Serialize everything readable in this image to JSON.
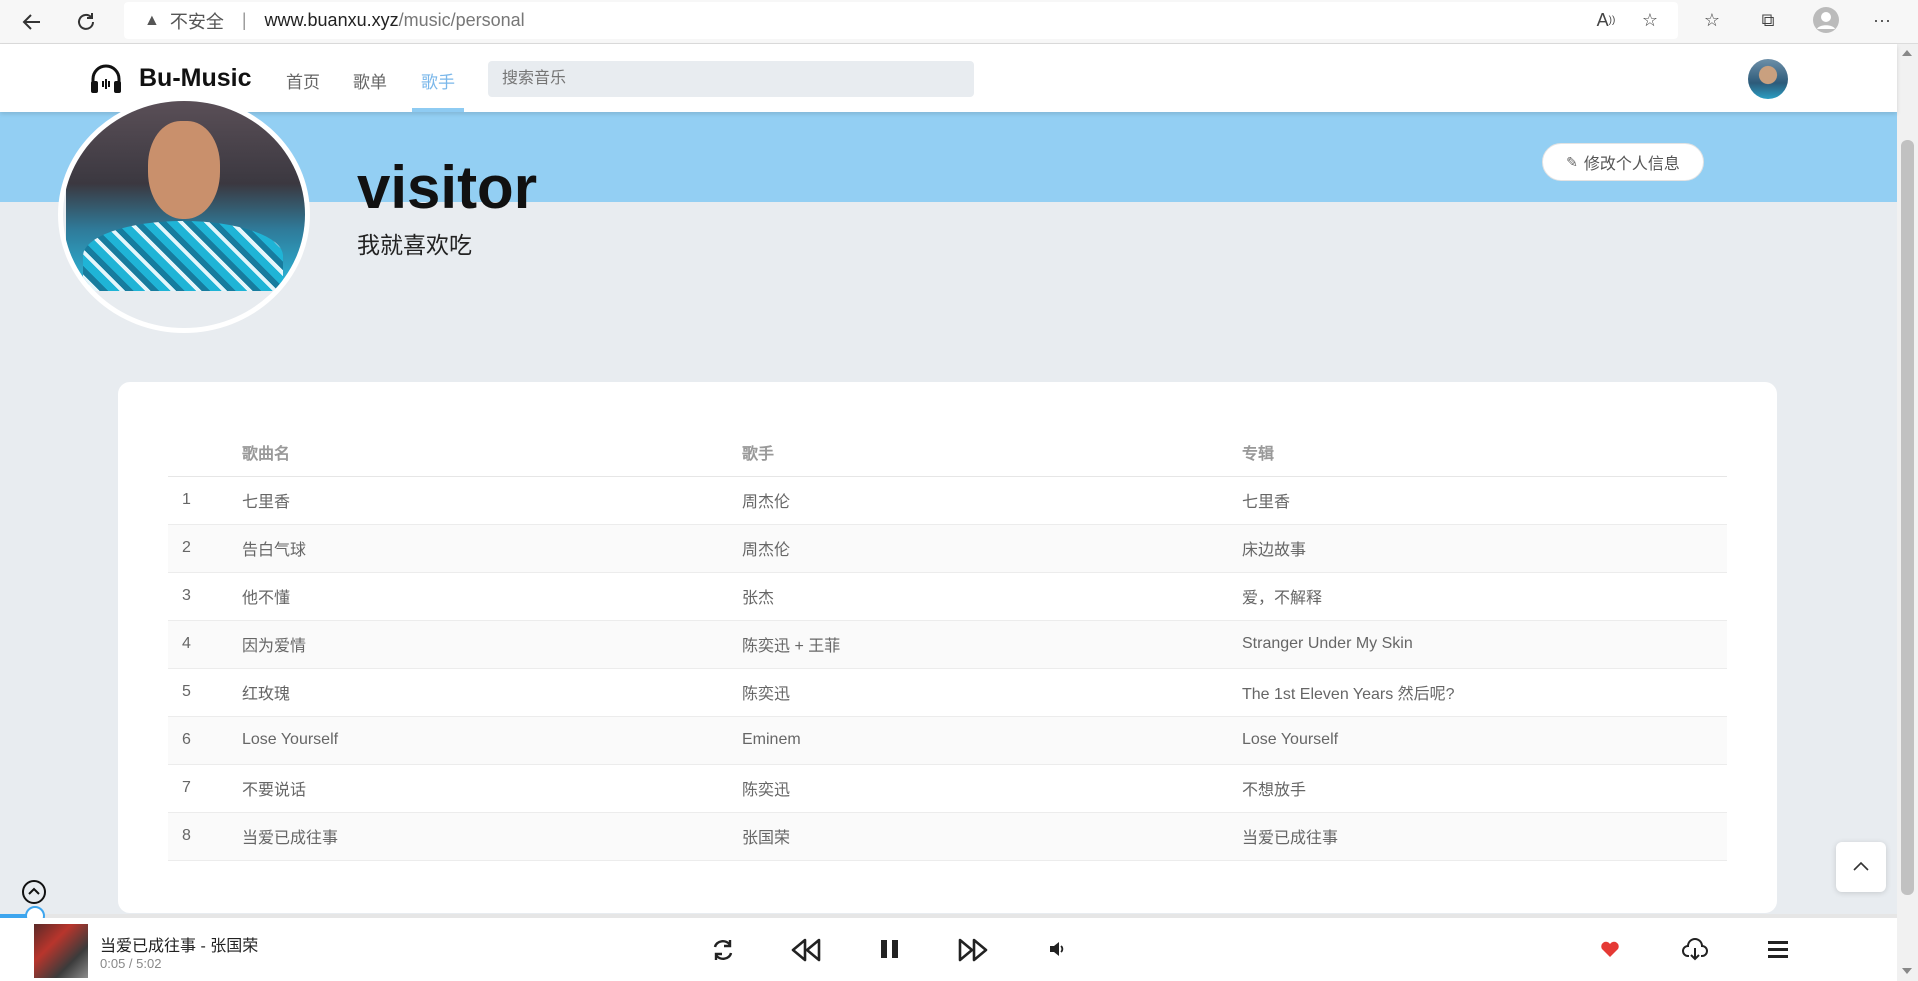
{
  "browser": {
    "insecure_label": "不安全",
    "url_host": "www.buanxu.xyz",
    "url_path": "/music/personal"
  },
  "header": {
    "brand": "Bu-Music",
    "nav": [
      {
        "label": "首页",
        "active": false
      },
      {
        "label": "歌单",
        "active": false
      },
      {
        "label": "歌手",
        "active": true
      }
    ],
    "search_placeholder": "搜索音乐"
  },
  "profile": {
    "username": "visitor",
    "bio": "我就喜欢吃",
    "edit_label": "修改个人信息"
  },
  "table": {
    "columns": [
      "歌曲名",
      "歌手",
      "专辑"
    ],
    "rows": [
      {
        "index": "1",
        "name": "七里香",
        "artist": "周杰伦",
        "album": "七里香"
      },
      {
        "index": "2",
        "name": "告白气球",
        "artist": "周杰伦",
        "album": "床边故事"
      },
      {
        "index": "3",
        "name": "他不懂",
        "artist": "张杰",
        "album": "爱，不解释"
      },
      {
        "index": "4",
        "name": "因为爱情",
        "artist": "陈奕迅 + 王菲",
        "album": "Stranger Under My Skin"
      },
      {
        "index": "5",
        "name": "红玫瑰",
        "artist": "陈奕迅",
        "album": "The 1st Eleven Years 然后呢?"
      },
      {
        "index": "6",
        "name": "Lose Yourself",
        "artist": "Eminem",
        "album": "Lose Yourself"
      },
      {
        "index": "7",
        "name": "不要说话",
        "artist": "陈奕迅",
        "album": "不想放手"
      },
      {
        "index": "8",
        "name": "当爱已成往事",
        "artist": "张国荣",
        "album": "当爱已成往事"
      }
    ]
  },
  "player": {
    "now_playing": "当爱已成往事 - 张国荣",
    "time": "0:05 / 5:02",
    "progress_fraction": 0.017,
    "liked_color": "#e53935",
    "accent": "#3da5ee"
  },
  "colors": {
    "banner": "#93cff3",
    "nav_active": "#7ab7ea"
  }
}
